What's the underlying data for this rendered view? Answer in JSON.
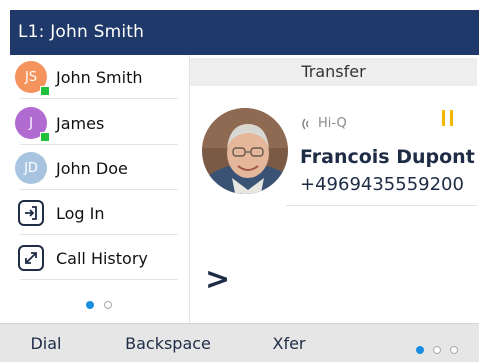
{
  "title_bar": {
    "text": "L1: John Smith"
  },
  "sidebar": {
    "contacts": [
      {
        "initials": "JS",
        "label": "John Smith",
        "avatar_color": "#f5935c",
        "presence": "available"
      },
      {
        "initials": "J",
        "label": "James",
        "avatar_color": "#b06ad0",
        "presence": "available"
      },
      {
        "initials": "JD",
        "label": "John Doe",
        "avatar_color": "#a8c4e0",
        "presence": ""
      }
    ],
    "actions": [
      {
        "icon": "log-in-icon",
        "label": "Log In"
      },
      {
        "icon": "call-history-icon",
        "label": "Call History"
      }
    ],
    "pager": {
      "pages": 2,
      "current": 1
    }
  },
  "main": {
    "header": "Transfer",
    "caller": {
      "hd_label": "Hi-Q",
      "name": "Francois Dupont",
      "number": "+4969435559200",
      "status_icon": "hold-pause-icon",
      "status_color": "#f2b700"
    },
    "prompt": ">"
  },
  "softkeys": {
    "items": [
      "Dial",
      "Backspace",
      "Xfer"
    ],
    "pager": {
      "pages": 3,
      "current": 1
    }
  },
  "colors": {
    "title_bar": "#1f3a6a",
    "presence_available": "#21c13a",
    "accent": "#1a8fe0"
  }
}
